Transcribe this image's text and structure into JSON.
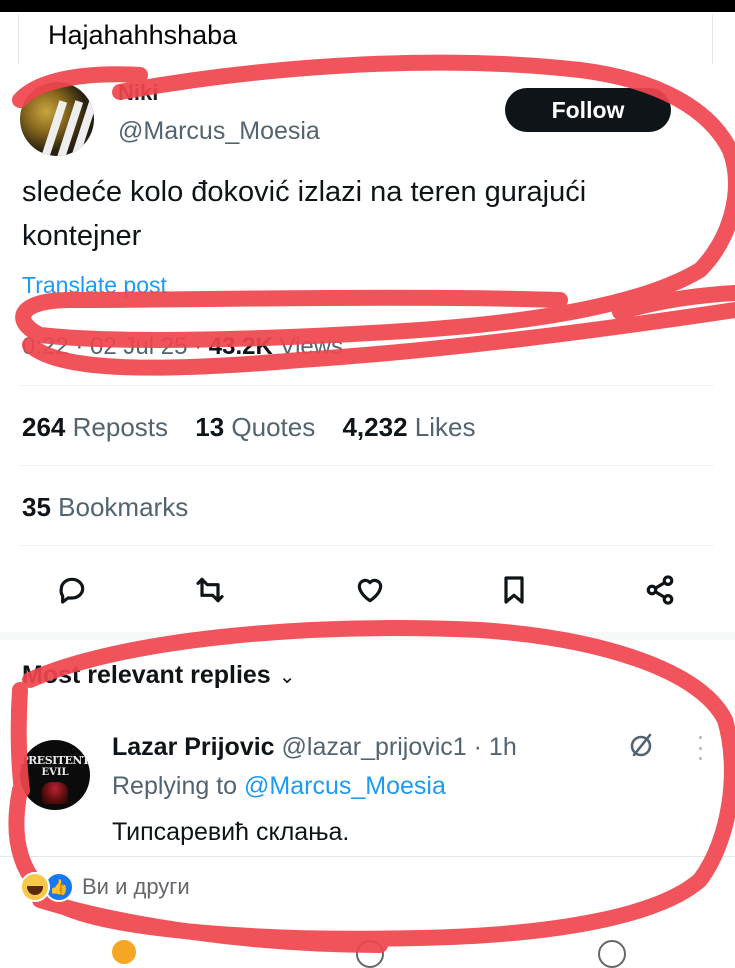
{
  "facebook_post": {
    "caption": "Hajahahhshaba"
  },
  "tweet": {
    "author_name": "Niki",
    "author_handle": "@Marcus_Moesia",
    "follow_label": "Follow",
    "text": "sledeće kolo đoković izlazi na teren gurajući kontejner",
    "translate_label": "Translate post",
    "timestamp": "0:22 · 02 Jul 25 · ",
    "views_count": "43.2K",
    "views_label": "Views",
    "stats": {
      "reposts_count": "264",
      "reposts_label": "Reposts",
      "quotes_count": "13",
      "quotes_label": "Quotes",
      "likes_count": "4,232",
      "likes_label": "Likes",
      "bookmarks_count": "35",
      "bookmarks_label": "Bookmarks"
    },
    "actions": [
      "reply-icon",
      "retweet-icon",
      "heart-icon",
      "bookmark-icon",
      "share-icon"
    ]
  },
  "replies": {
    "header": "Most relevant replies",
    "items": [
      {
        "avatar_text_line1": "PRESITENT",
        "avatar_text_line2": "EVIL",
        "name": "Lazar Prijovic",
        "handle_time": "@lazar_prijovic1 · 1h",
        "replying_prefix": "Replying to ",
        "replying_to": "@Marcus_Moesia",
        "text": "Типсаревић склања."
      }
    ]
  },
  "facebook_reactions": {
    "summary": "Ви и други",
    "icons": [
      "haha-reaction-icon",
      "like-reaction-icon"
    ]
  },
  "colors": {
    "accent_blue": "#1d9bf0",
    "scribble_red": "#f0454e",
    "text_dark": "#0f1419",
    "text_muted": "#536471"
  }
}
